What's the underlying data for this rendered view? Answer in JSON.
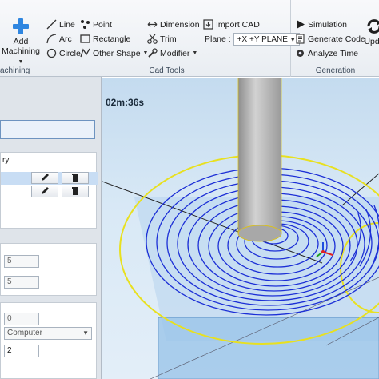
{
  "ribbon": {
    "machining": {
      "add_label": "Add",
      "machining_label": "Machining",
      "group_label": "achining"
    },
    "cad_tools": {
      "group_label": "Cad Tools",
      "line": "Line",
      "point": "Point",
      "arc": "Arc",
      "rectangle": "Rectangle",
      "circle": "Circle",
      "other_shape": "Other Shape",
      "dimension": "Dimension",
      "trim": "Trim",
      "modifier": "Modifier",
      "import_cad": "Import CAD",
      "plane_label": "Plane :",
      "plane_value": "+X +Y PLANE"
    },
    "generation": {
      "group_label": "Generation",
      "simulation": "Simulation",
      "generate_code": "Generate Code",
      "analyze_time": "Analyze Time",
      "update": "Upda"
    }
  },
  "left_panel": {
    "geometry_header": "ry",
    "fields": {
      "field1": "5",
      "field2": "5",
      "field3": "0",
      "dropdown": "Computer",
      "field4": "2"
    }
  },
  "viewport": {
    "timer": "02m:36s",
    "colors": {
      "toolpath": "#1c2fd6",
      "boundary": "#e8e020",
      "stock": "#9cc6ea",
      "tool": "#b9b9b9"
    }
  }
}
